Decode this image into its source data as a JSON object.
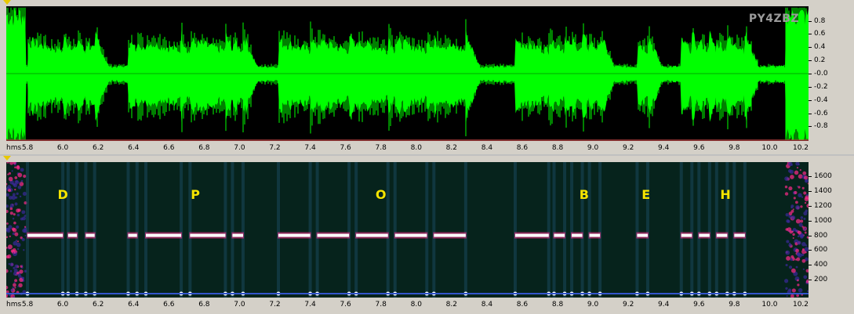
{
  "window": {
    "watermark": "PY4ZBZ"
  },
  "waveform": {
    "y_ticks": [
      "0.8",
      "0.6",
      "0.4",
      "0.2",
      "-0.0",
      "-0.2",
      "-0.4",
      "-0.6",
      "-0.8"
    ],
    "y_values": [
      0.8,
      0.6,
      0.4,
      0.2,
      0.0,
      -0.2,
      -0.4,
      -0.6,
      -0.8
    ],
    "color": "#00ff00"
  },
  "spectrogram": {
    "y_ticks": [
      "1600",
      "1400",
      "1200",
      "1000",
      "800",
      "600",
      "400",
      "200"
    ],
    "y_values": [
      1600,
      1400,
      1200,
      1000,
      800,
      600,
      400,
      200
    ],
    "tone_hz": 800,
    "letters": [
      {
        "text": "D",
        "t": 6.0
      },
      {
        "text": "P",
        "t": 6.75
      },
      {
        "text": "O",
        "t": 7.8
      },
      {
        "text": "B",
        "t": 8.95
      },
      {
        "text": "E",
        "t": 9.3
      },
      {
        "text": "H",
        "t": 9.75
      }
    ],
    "morse_elements": [
      {
        "start": 5.8,
        "end": 6.0
      },
      {
        "start": 6.03,
        "end": 6.08
      },
      {
        "start": 6.13,
        "end": 6.18
      },
      {
        "start": 6.37,
        "end": 6.42
      },
      {
        "start": 6.47,
        "end": 6.67
      },
      {
        "start": 6.72,
        "end": 6.92
      },
      {
        "start": 6.96,
        "end": 7.02
      },
      {
        "start": 7.22,
        "end": 7.4
      },
      {
        "start": 7.44,
        "end": 7.62
      },
      {
        "start": 7.66,
        "end": 7.84
      },
      {
        "start": 7.88,
        "end": 8.06
      },
      {
        "start": 8.1,
        "end": 8.28
      },
      {
        "start": 8.56,
        "end": 8.75
      },
      {
        "start": 8.78,
        "end": 8.84
      },
      {
        "start": 8.88,
        "end": 8.94
      },
      {
        "start": 8.98,
        "end": 9.04
      },
      {
        "start": 9.25,
        "end": 9.31
      },
      {
        "start": 9.5,
        "end": 9.56
      },
      {
        "start": 9.6,
        "end": 9.66
      },
      {
        "start": 9.7,
        "end": 9.76
      },
      {
        "start": 9.8,
        "end": 9.86
      }
    ]
  },
  "time_axis": {
    "unit": "hms",
    "ticks": [
      "5.8",
      "6.0",
      "6.2",
      "6.4",
      "6.6",
      "6.8",
      "7.0",
      "7.2",
      "7.4",
      "7.6",
      "7.8",
      "8.0",
      "8.2",
      "8.4",
      "8.6",
      "8.8",
      "9.0",
      "9.2",
      "9.4",
      "9.6",
      "9.8",
      "10.0",
      "10.2"
    ],
    "tick_values": [
      5.8,
      6.0,
      6.2,
      6.4,
      6.6,
      6.8,
      7.0,
      7.2,
      7.4,
      7.6,
      7.8,
      8.0,
      8.2,
      8.4,
      8.6,
      8.8,
      9.0,
      9.2,
      9.4,
      9.6,
      9.8,
      10.0,
      10.2
    ],
    "range": [
      5.68,
      10.22
    ]
  },
  "colors": {
    "plot_bg": "#000000",
    "spec_bg": "#06231c",
    "tone": "#ffffff",
    "halo": "#ff2a8a",
    "letters": "#f5e400"
  }
}
